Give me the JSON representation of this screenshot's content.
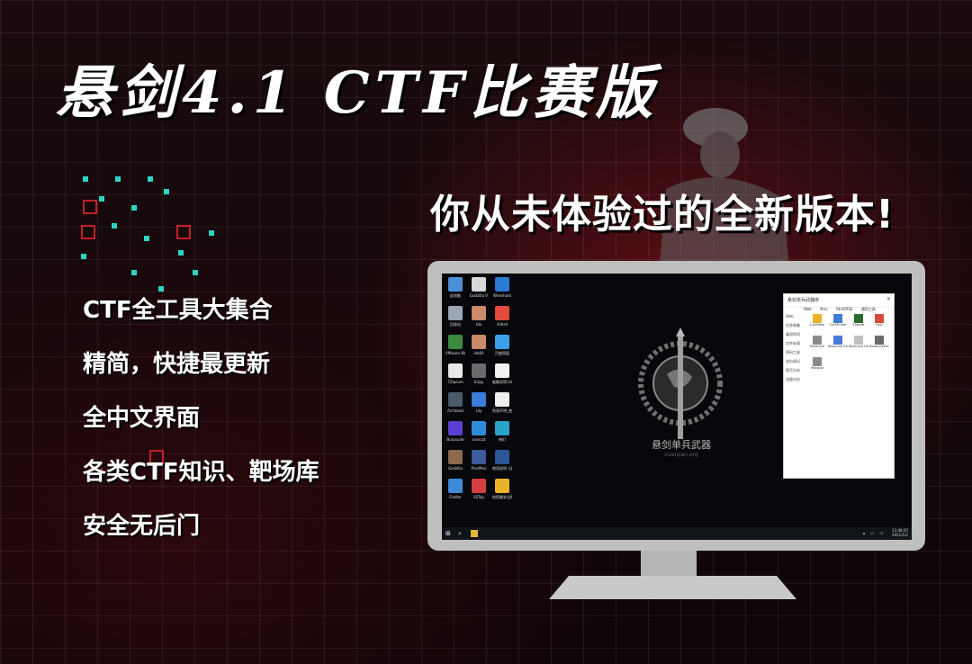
{
  "poster": {
    "title": "悬剑4.1 CTF比赛版",
    "slogan": "你从未体验过的全新版本!",
    "features": [
      "CTF全工具大集合",
      "精简，快捷最更新",
      "全中文界面",
      "各类CTF知识、靶场库",
      "安全无后门"
    ],
    "colors": {
      "accent_teal": "#2fd3c4",
      "accent_red": "#c21f2a",
      "background": "#12080a"
    }
  },
  "desktop": {
    "icons": [
      {
        "label": "此电脑",
        "color": "#4a90d9",
        "icon": "computer-icon"
      },
      {
        "label": "Godzilla V",
        "color": "#d8d8d8",
        "icon": "app-icon"
      },
      {
        "label": "Wireshark",
        "color": "#2a7ad6",
        "icon": "wireshark-icon"
      },
      {
        "label": "回收站",
        "color": "#9aa7b5",
        "icon": "recycle-bin-icon"
      },
      {
        "label": "Ida",
        "color": "#c98a6a",
        "icon": "ida-icon"
      },
      {
        "label": "Xshell",
        "color": "#e24a3b",
        "icon": "xshell-icon"
      },
      {
        "label": "VMware Workstati",
        "color": "#3c8a3f",
        "icon": "vmware-icon"
      },
      {
        "label": "ida64",
        "color": "#c98a6a",
        "icon": "ida64-icon"
      },
      {
        "label": "百度网盘",
        "color": "#3aa0ea",
        "icon": "baidu-netdisk-icon"
      },
      {
        "label": "7Zipcom",
        "color": "#e8e8e8",
        "icon": "7zip-icon"
      },
      {
        "label": "ILSpy",
        "color": "#6b6b6b",
        "icon": "ilspy-icon"
      },
      {
        "label": "破解说明.txt",
        "color": "#f0f0f0",
        "icon": "text-file-icon"
      },
      {
        "label": "Archbeat",
        "color": "#4a5a6a",
        "icon": "app-icon"
      },
      {
        "label": "Lily",
        "color": "#3c7dd9",
        "icon": "app-icon"
      },
      {
        "label": "免责声明_使用必看.txt",
        "color": "#f0f0f0",
        "icon": "text-file-icon"
      },
      {
        "label": "Burpsuite",
        "color": "#5b3fd1",
        "icon": "burpsuite-icon"
      },
      {
        "label": "navicat",
        "color": "#2e8bd6",
        "icon": "navicat-icon"
      },
      {
        "label": "神们",
        "color": "#2aa3c9",
        "icon": "app-icon"
      },
      {
        "label": "Godzilla",
        "color": "#8a6a4a",
        "icon": "app-icon"
      },
      {
        "label": "ProcMon",
        "color": "#3d5a9a",
        "icon": "procmon-icon"
      },
      {
        "label": "使用说明【必看】.docx",
        "color": "#2b5797",
        "icon": "word-file-icon"
      },
      {
        "label": "Fiddler",
        "color": "#3f8ad6",
        "icon": "fiddler-icon"
      },
      {
        "label": "SSTap",
        "color": "#d63f3f",
        "icon": "sstap-icon"
      },
      {
        "label": "给您最安全稳定的模拟 K...",
        "color": "#e9b32a",
        "icon": "chrome-icon"
      }
    ],
    "brand": "悬剑单兵武器",
    "brand_sub": "xuanjian.org",
    "window": {
      "title": "悬剑单兵武器库",
      "tabs": [
        "Web",
        "Misc",
        "REVERSE",
        "通用工具"
      ],
      "sidebar": [
        "Web",
        "信息收集",
        "漏洞利用",
        "文件处理",
        "密码工具",
        "逆向调试",
        "隐写分析",
        "流量分析"
      ],
      "apps": [
        {
          "label": "ConfWeb",
          "color": "#e9b32a"
        },
        {
          "label": "ClickFinder",
          "color": "#3e7dd6"
        },
        {
          "label": "Exeinfo",
          "color": "#2d6b2d"
        },
        {
          "label": "HxD",
          "color": "#d64a3b"
        },
        {
          "label": "Resource",
          "color": "#8a8a8a"
        },
        {
          "label": "Resource Extract",
          "color": "#4a7ad6"
        },
        {
          "label": "Resource Hacker",
          "color": "#c0c0c0"
        },
        {
          "label": "ResourceExtract",
          "color": "#6a6a6a"
        },
        {
          "label": "Resspot",
          "color": "#8a8a8a"
        }
      ]
    },
    "taskbar": {
      "clock_time": "12:48:05",
      "clock_date": "2021/12/"
    }
  }
}
